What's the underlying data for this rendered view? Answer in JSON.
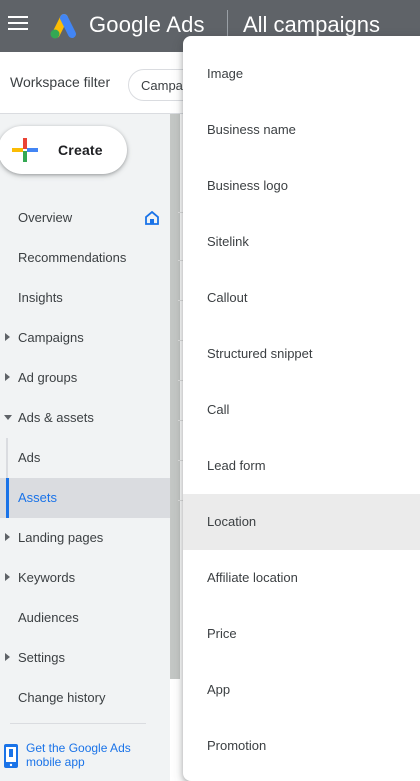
{
  "header": {
    "brand": "Google Ads",
    "page_title": "All campaigns"
  },
  "filter": {
    "label": "Workspace filter",
    "chip": "Campaigns"
  },
  "sidebar": {
    "create_label": "Create",
    "items": [
      {
        "label": "Overview"
      },
      {
        "label": "Recommendations"
      },
      {
        "label": "Insights"
      },
      {
        "label": "Campaigns"
      },
      {
        "label": "Ad groups"
      },
      {
        "label": "Ads & assets"
      },
      {
        "label": "Ads"
      },
      {
        "label": "Assets"
      },
      {
        "label": "Landing pages"
      },
      {
        "label": "Keywords"
      },
      {
        "label": "Audiences"
      },
      {
        "label": "Settings"
      },
      {
        "label": "Change history"
      }
    ],
    "mobile_app_link": "Get the Google Ads mobile app"
  },
  "dropdown": {
    "items": [
      {
        "label": "Image"
      },
      {
        "label": "Business name"
      },
      {
        "label": "Business logo"
      },
      {
        "label": "Sitelink"
      },
      {
        "label": "Callout"
      },
      {
        "label": "Structured snippet"
      },
      {
        "label": "Call"
      },
      {
        "label": "Lead form"
      },
      {
        "label": "Location"
      },
      {
        "label": "Affiliate location"
      },
      {
        "label": "Price"
      },
      {
        "label": "App"
      },
      {
        "label": "Promotion"
      }
    ]
  },
  "colors": {
    "topbar": "#5f6368",
    "accent": "#1a73e8",
    "sidebar_bg": "#f1f3f4",
    "hover_row": "#ebebeb"
  }
}
